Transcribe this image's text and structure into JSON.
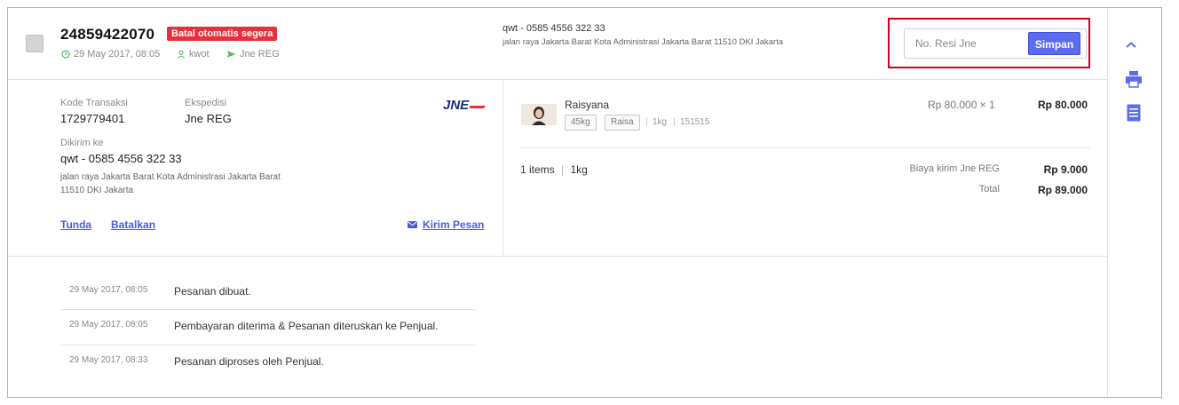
{
  "order": {
    "id": "24859422070",
    "badge": "Batal otomatis segera",
    "date": "29 May 2017, 08:05",
    "buyer": "kwot",
    "courier": "Jne REG"
  },
  "header_address": {
    "name_phone": "qwt - 0585 4556 322 33",
    "address": "jalan raya Jakarta Barat Kota Administrasi Jakarta Barat 11510 DKI Jakarta"
  },
  "resi": {
    "placeholder": "No. Resi Jne",
    "value": "",
    "save_label": "Simpan"
  },
  "details": {
    "kode_label": "Kode Transaksi",
    "kode_value": "1729779401",
    "ekspedisi_label": "Ekspedisi",
    "ekspedisi_value": "Jne REG",
    "dikirim_label": "Dikirim ke",
    "recipient": "qwt - 0585 4556 322 33",
    "address_line1": "jalan raya Jakarta Barat Kota Administrasi Jakarta Barat",
    "address_line2": "11510 DKI Jakarta",
    "logo_text": "JNE",
    "links": {
      "tunda": "Tunda",
      "batalkan": "Batalkan",
      "kirim_pesan": "Kirim Pesan"
    }
  },
  "product": {
    "name": "Raisyana",
    "tag1": "45kg",
    "tag2": "Raisa",
    "weight": "1kg",
    "sku": "151515",
    "unit_price": "Rp 80.000 × 1",
    "line_total": "Rp 80.000"
  },
  "summary": {
    "items": "1 items",
    "weight": "1kg",
    "shipping_label": "Biaya kirim Jne REG",
    "shipping_value": "Rp 9.000",
    "total_label": "Total",
    "total_value": "Rp 89.000"
  },
  "history": [
    {
      "time": "29 May 2017, 08:05",
      "message": "Pesanan dibuat."
    },
    {
      "time": "29 May 2017, 08:05",
      "message": "Pembayaran diterima & Pesanan diteruskan ke Penjual."
    },
    {
      "time": "29 May 2017, 08:33",
      "message": "Pesanan diproses oleh Penjual."
    }
  ],
  "colors": {
    "accent": "#5c6bf0",
    "badge": "#e8303b",
    "highlight": "#d0021b",
    "link": "#4a5be0"
  },
  "icons": [
    "clock-icon",
    "user-icon",
    "send-icon",
    "chevron-up-icon",
    "print-icon",
    "document-icon",
    "mail-icon"
  ]
}
